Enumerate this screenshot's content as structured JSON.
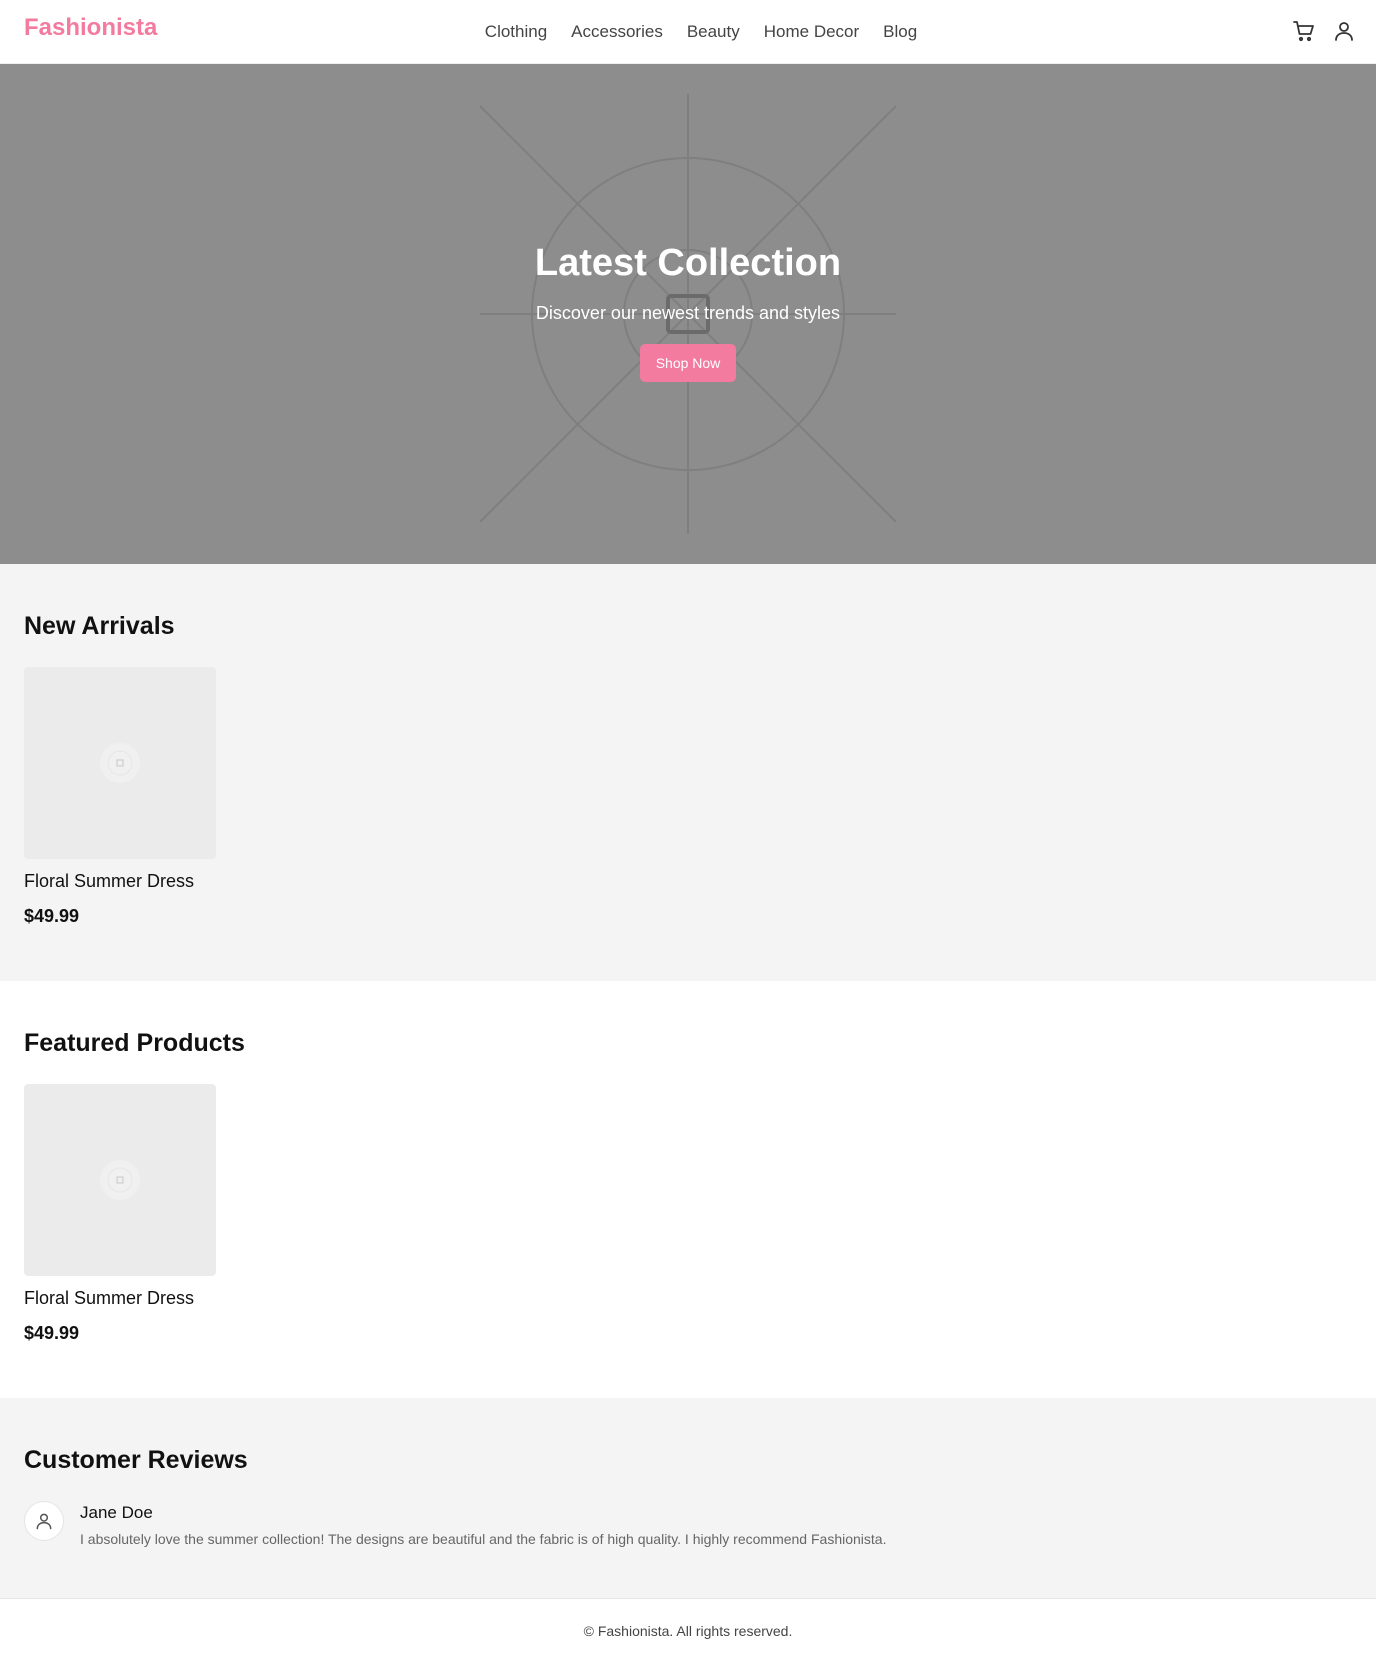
{
  "header": {
    "logo": "Fashionista",
    "nav": [
      "Clothing",
      "Accessories",
      "Beauty",
      "Home Decor",
      "Blog"
    ],
    "icons": [
      "cart-icon",
      "user-icon"
    ]
  },
  "hero": {
    "title": "Latest Collection",
    "subtitle": "Discover our newest trends and styles",
    "button": "Shop Now"
  },
  "new_arrivals": {
    "title": "New Arrivals",
    "products": [
      {
        "name": "Floral Summer Dress",
        "price": "$49.99"
      }
    ]
  },
  "featured": {
    "title": "Featured Products",
    "products": [
      {
        "name": "Floral Summer Dress",
        "price": "$49.99"
      }
    ]
  },
  "reviews": {
    "title": "Customer Reviews",
    "items": [
      {
        "name": "Jane Doe",
        "text": "I absolutely love the summer collection! The designs are beautiful and the fabric is of high quality. I highly recommend Fashionista."
      }
    ]
  },
  "footer": {
    "text": "© Fashionista. All rights reserved."
  },
  "colors": {
    "accent": "#f37ba0",
    "hero_bg": "#8d8d8d",
    "section_gray": "#f4f4f4"
  }
}
